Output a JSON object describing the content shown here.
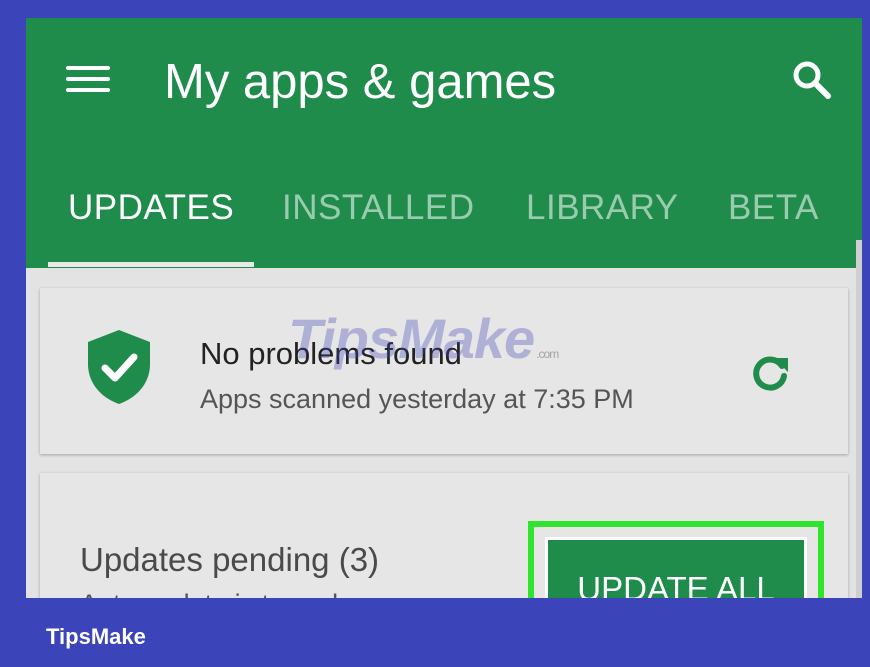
{
  "appbar": {
    "title": "My apps & games",
    "tabs": [
      {
        "label": "UPDATES",
        "active": true
      },
      {
        "label": "INSTALLED",
        "active": false
      },
      {
        "label": "LIBRARY",
        "active": false
      },
      {
        "label": "BETA",
        "active": false
      }
    ]
  },
  "security_card": {
    "title": "No problems found",
    "subtitle": "Apps scanned yesterday at 7:35 PM",
    "icon": "shield-check-icon",
    "refresh_icon": "refresh-icon"
  },
  "updates_card": {
    "title": "Updates pending (3)",
    "subtitle": "Auto-update is turned on",
    "button_label": "UPDATE ALL"
  },
  "watermark": {
    "text": "TipsMake",
    "suffix": ".com"
  },
  "footer": {
    "brand": "TipsMake"
  },
  "colors": {
    "primary_green": "#1f8c4c",
    "frame_blue": "#3b44b8",
    "highlight_green": "#2fe32f",
    "card_bg": "#e6e6e6"
  }
}
